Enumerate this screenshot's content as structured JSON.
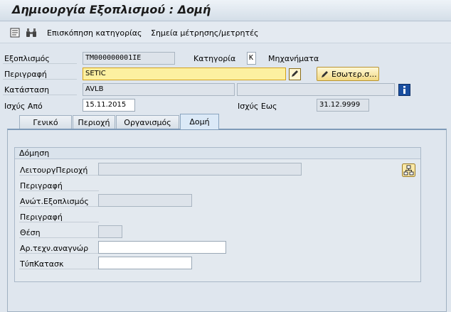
{
  "window": {
    "title": "Δημιουργία Εξοπλισμού : Δομή"
  },
  "toolbar": {
    "items": [
      {
        "label": "Επισκόπηση κατηγορίας"
      },
      {
        "label": "Σημεία μέτρησης/μετρητές"
      }
    ]
  },
  "header": {
    "equipment_label": "Εξοπλισμός",
    "equipment_value": "TM000000001IE",
    "category_label": "Κατηγορία",
    "category_value": "K",
    "category_text": "Μηχανήματα",
    "description_label": "Περιγραφή",
    "description_value": "SETIC",
    "internal_note_label": "Εσωτερ.σ...",
    "status_label": "Κατάσταση",
    "status_value": "AVLB",
    "status_extra_value": "",
    "valid_from_label": "Ισχύς Από",
    "valid_from_value": "15.11.2015",
    "valid_to_label": "Ισχύς Εως",
    "valid_to_value": "31.12.9999"
  },
  "tabs": [
    {
      "label": "Γενικό",
      "active": false
    },
    {
      "label": "Περιοχή",
      "active": false
    },
    {
      "label": "Οργανισμός",
      "active": false
    },
    {
      "label": "Δομή",
      "active": true
    }
  ],
  "structure": {
    "group_title": "Δόμηση",
    "func_location_label": "ΛειτουργΠεριοχή",
    "func_location_value": "",
    "func_location_desc_label": "Περιγραφή",
    "superior_equipment_label": "Ανώτ.Εξοπλισμός",
    "superior_equipment_value": "",
    "superior_equipment_desc_label": "Περιγραφή",
    "position_label": "Θέση",
    "position_value": "",
    "tech_id_label": "Αρ.τεχν.αναγνώρ",
    "tech_id_value": "",
    "construction_type_label": "ΤύπΚατασκ",
    "construction_type_value": ""
  },
  "colors": {
    "background": "#dfe6ee",
    "active_field": "#fcf0a0",
    "button": "#f2d983",
    "info_button": "#1a4fa0"
  }
}
